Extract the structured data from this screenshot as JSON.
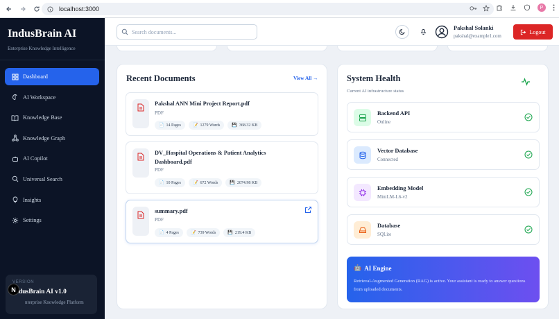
{
  "browser": {
    "url": "localhost:3000",
    "profile_initial": "P"
  },
  "sidebar": {
    "brand": "IndusBrain AI",
    "tagline": "Enterprise Knowledge Intelligence",
    "items": [
      {
        "label": "Dashboard",
        "icon": "dashboard-icon",
        "active": true
      },
      {
        "label": "AI Workspace",
        "icon": "brain-icon"
      },
      {
        "label": "Knowledge Base",
        "icon": "book-icon"
      },
      {
        "label": "Knowledge Graph",
        "icon": "network-icon"
      },
      {
        "label": "AI Copilot",
        "icon": "bot-icon"
      },
      {
        "label": "Universal Search",
        "icon": "search-icon"
      },
      {
        "label": "Insights",
        "icon": "lightbulb-icon"
      },
      {
        "label": "Settings",
        "icon": "gear-icon"
      }
    ],
    "version_label": "VERSION",
    "version_title": "IndusBrain AI v1.0",
    "version_sub": "nterprise Knowledge Platform"
  },
  "header": {
    "search_placeholder": "Search documents...",
    "user_name": "Pakshal Solanki",
    "user_email": "pakshal@example1.com",
    "logout_label": "Logout"
  },
  "recent": {
    "title": "Recent Documents",
    "view_all": "View All →",
    "docs": [
      {
        "name": "Pakshal ANN Mini Project Report.pdf",
        "type": "PDF",
        "pages": "14 Pages",
        "words": "1279 Words",
        "size": "368.32 KB"
      },
      {
        "name": "DV_Hospital Operations & Patient Analytics Dashboard.pdf",
        "type": "PDF",
        "pages": "10 Pages",
        "words": "672 Words",
        "size": "2074.98 KB"
      },
      {
        "name": "summary.pdf",
        "type": "PDF",
        "pages": "4 Pages",
        "words": "739 Words",
        "size": "219.4 KB"
      }
    ]
  },
  "health": {
    "title": "System Health",
    "subtitle": "Current AI infrastructure status",
    "services": [
      {
        "name": "Backend API",
        "status": "Online",
        "icon": "server-icon",
        "color": "#16a34a",
        "bg": "#dcfce7"
      },
      {
        "name": "Vector Database",
        "status": "Connected",
        "icon": "database-icon",
        "color": "#2563eb",
        "bg": "#dbeafe"
      },
      {
        "name": "Embedding Model",
        "status": "MiniLM-L6-v2",
        "icon": "cpu-icon",
        "color": "#9333ea",
        "bg": "#f3e8ff"
      },
      {
        "name": "Database",
        "status": "SQLite",
        "icon": "hard-drive-icon",
        "color": "#ea580c",
        "bg": "#ffedd5"
      }
    ],
    "engine_title": "AI Engine",
    "engine_text": "Retrieval-Augmented Generation (RAG) is active. Your assistant is ready to answer questions from uploaded documents."
  },
  "colors": {
    "accent": "#2563eb",
    "sidebar_bg": "#0c1426",
    "logout": "#dc2626",
    "success": "#16a34a"
  }
}
